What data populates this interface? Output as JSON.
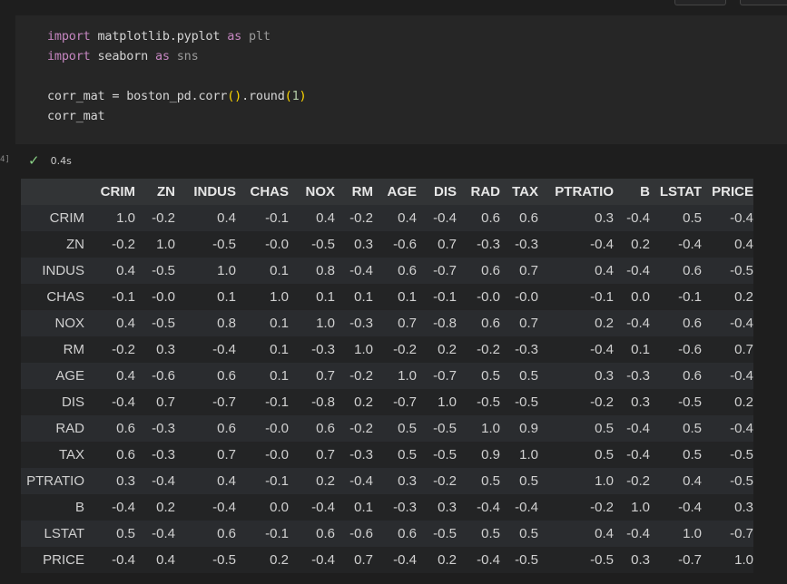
{
  "code_cell": {
    "lines": [
      [
        {
          "t": "import",
          "c": "kw"
        },
        {
          "t": " matplotlib.pyplot ",
          "c": ""
        },
        {
          "t": "as",
          "c": "kw"
        },
        {
          "t": " plt",
          "c": "alias"
        }
      ],
      [
        {
          "t": "import",
          "c": "kw"
        },
        {
          "t": " seaborn ",
          "c": ""
        },
        {
          "t": "as",
          "c": "kw"
        },
        {
          "t": " sns",
          "c": "alias"
        }
      ],
      [],
      [
        {
          "t": "corr_mat = boston_pd.corr",
          "c": ""
        },
        {
          "t": "()",
          "c": "paren"
        },
        {
          "t": ".round",
          "c": ""
        },
        {
          "t": "(",
          "c": "paren"
        },
        {
          "t": "1",
          "c": "num"
        },
        {
          "t": ")",
          "c": "paren"
        }
      ],
      [
        {
          "t": "corr_mat",
          "c": ""
        }
      ]
    ]
  },
  "execution": {
    "gutter_label": "4]",
    "status_icon": "check-icon",
    "duration": "0.4s"
  },
  "table": {
    "columns": [
      "CRIM",
      "ZN",
      "INDUS",
      "CHAS",
      "NOX",
      "RM",
      "AGE",
      "DIS",
      "RAD",
      "TAX",
      "PTRATIO",
      "B",
      "LSTAT",
      "PRICE"
    ],
    "rows": [
      {
        "label": "CRIM",
        "values": [
          "1.0",
          "-0.2",
          "0.4",
          "-0.1",
          "0.4",
          "-0.2",
          "0.4",
          "-0.4",
          "0.6",
          "0.6",
          "0.3",
          "-0.4",
          "0.5",
          "-0.4"
        ]
      },
      {
        "label": "ZN",
        "values": [
          "-0.2",
          "1.0",
          "-0.5",
          "-0.0",
          "-0.5",
          "0.3",
          "-0.6",
          "0.7",
          "-0.3",
          "-0.3",
          "-0.4",
          "0.2",
          "-0.4",
          "0.4"
        ]
      },
      {
        "label": "INDUS",
        "values": [
          "0.4",
          "-0.5",
          "1.0",
          "0.1",
          "0.8",
          "-0.4",
          "0.6",
          "-0.7",
          "0.6",
          "0.7",
          "0.4",
          "-0.4",
          "0.6",
          "-0.5"
        ]
      },
      {
        "label": "CHAS",
        "values": [
          "-0.1",
          "-0.0",
          "0.1",
          "1.0",
          "0.1",
          "0.1",
          "0.1",
          "-0.1",
          "-0.0",
          "-0.0",
          "-0.1",
          "0.0",
          "-0.1",
          "0.2"
        ]
      },
      {
        "label": "NOX",
        "values": [
          "0.4",
          "-0.5",
          "0.8",
          "0.1",
          "1.0",
          "-0.3",
          "0.7",
          "-0.8",
          "0.6",
          "0.7",
          "0.2",
          "-0.4",
          "0.6",
          "-0.4"
        ]
      },
      {
        "label": "RM",
        "values": [
          "-0.2",
          "0.3",
          "-0.4",
          "0.1",
          "-0.3",
          "1.0",
          "-0.2",
          "0.2",
          "-0.2",
          "-0.3",
          "-0.4",
          "0.1",
          "-0.6",
          "0.7"
        ]
      },
      {
        "label": "AGE",
        "values": [
          "0.4",
          "-0.6",
          "0.6",
          "0.1",
          "0.7",
          "-0.2",
          "1.0",
          "-0.7",
          "0.5",
          "0.5",
          "0.3",
          "-0.3",
          "0.6",
          "-0.4"
        ]
      },
      {
        "label": "DIS",
        "values": [
          "-0.4",
          "0.7",
          "-0.7",
          "-0.1",
          "-0.8",
          "0.2",
          "-0.7",
          "1.0",
          "-0.5",
          "-0.5",
          "-0.2",
          "0.3",
          "-0.5",
          "0.2"
        ]
      },
      {
        "label": "RAD",
        "values": [
          "0.6",
          "-0.3",
          "0.6",
          "-0.0",
          "0.6",
          "-0.2",
          "0.5",
          "-0.5",
          "1.0",
          "0.9",
          "0.5",
          "-0.4",
          "0.5",
          "-0.4"
        ]
      },
      {
        "label": "TAX",
        "values": [
          "0.6",
          "-0.3",
          "0.7",
          "-0.0",
          "0.7",
          "-0.3",
          "0.5",
          "-0.5",
          "0.9",
          "1.0",
          "0.5",
          "-0.4",
          "0.5",
          "-0.5"
        ]
      },
      {
        "label": "PTRATIO",
        "values": [
          "0.3",
          "-0.4",
          "0.4",
          "-0.1",
          "0.2",
          "-0.4",
          "0.3",
          "-0.2",
          "0.5",
          "0.5",
          "1.0",
          "-0.2",
          "0.4",
          "-0.5"
        ]
      },
      {
        "label": "B",
        "values": [
          "-0.4",
          "0.2",
          "-0.4",
          "0.0",
          "-0.4",
          "0.1",
          "-0.3",
          "0.3",
          "-0.4",
          "-0.4",
          "-0.2",
          "1.0",
          "-0.4",
          "0.3"
        ]
      },
      {
        "label": "LSTAT",
        "values": [
          "0.5",
          "-0.4",
          "0.6",
          "-0.1",
          "0.6",
          "-0.6",
          "0.6",
          "-0.5",
          "0.5",
          "0.5",
          "0.4",
          "-0.4",
          "1.0",
          "-0.7"
        ]
      },
      {
        "label": "PRICE",
        "values": [
          "-0.4",
          "0.4",
          "-0.5",
          "0.2",
          "-0.4",
          "0.7",
          "-0.4",
          "0.2",
          "-0.4",
          "-0.5",
          "-0.5",
          "0.3",
          "-0.7",
          "1.0"
        ]
      }
    ]
  }
}
